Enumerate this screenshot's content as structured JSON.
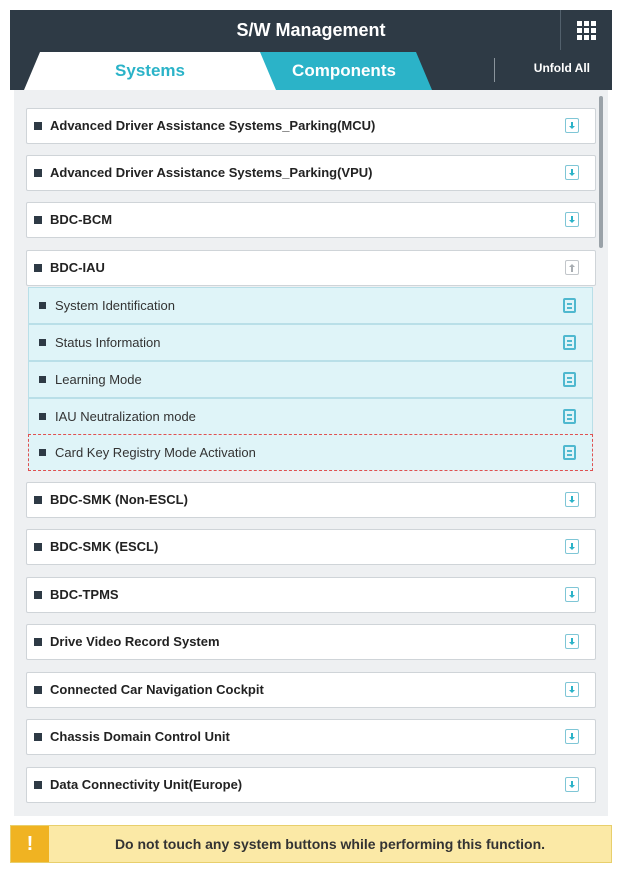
{
  "header": {
    "title": "S/W Management",
    "menu_icon": "grid-icon"
  },
  "tabs": [
    {
      "label": "Systems",
      "active": true
    },
    {
      "label": "Components",
      "active": false
    }
  ],
  "toolbar": {
    "unfold_label": "Unfold All"
  },
  "systems": [
    {
      "label": "Advanced Driver Assistance Systems_Parking(MCU)",
      "expanded": false
    },
    {
      "label": "Advanced Driver Assistance Systems_Parking(VPU)",
      "expanded": false
    },
    {
      "label": "BDC-BCM",
      "expanded": false
    },
    {
      "label": "BDC-IAU",
      "expanded": true
    },
    {
      "label": "BDC-SMK (Non-ESCL)",
      "expanded": false
    },
    {
      "label": "BDC-SMK (ESCL)",
      "expanded": false
    },
    {
      "label": "BDC-TPMS",
      "expanded": false
    },
    {
      "label": "Drive Video Record System",
      "expanded": false
    },
    {
      "label": "Connected Car Navigation Cockpit",
      "expanded": false
    },
    {
      "label": "Chassis Domain Control Unit",
      "expanded": false
    },
    {
      "label": "Data Connectivity Unit(Europe)",
      "expanded": false
    }
  ],
  "bdc_iau_functions": [
    {
      "label": "System Identification"
    },
    {
      "label": "Status Information"
    },
    {
      "label": "Learning Mode"
    },
    {
      "label": "IAU Neutralization mode"
    },
    {
      "label": "Card Key Registry Mode Activation",
      "selected": true
    }
  ],
  "warning": {
    "icon": "!",
    "text": "Do not touch any system buttons while performing this function."
  },
  "colors": {
    "header_bg": "#2e3a45",
    "accent": "#2bb3c8",
    "sub_bg": "#dff4f8",
    "warning_bg": "#fbe9a6",
    "warning_icon_bg": "#f0b322"
  }
}
